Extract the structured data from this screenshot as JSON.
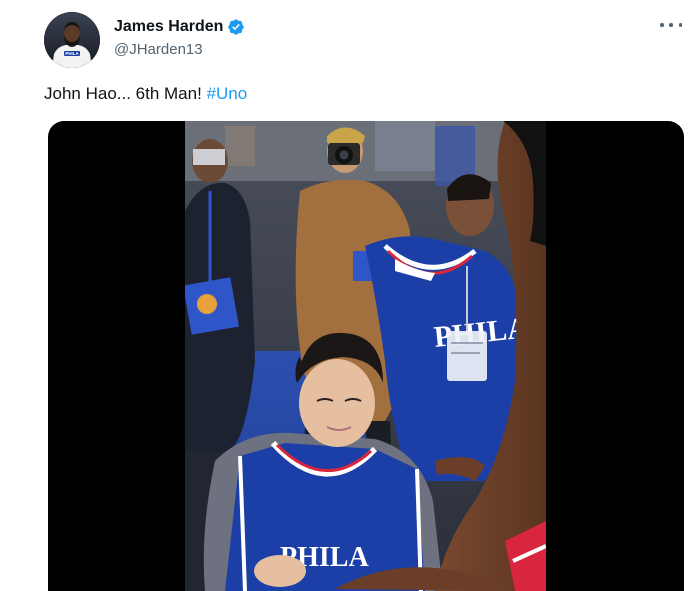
{
  "author": {
    "display_name": "James Harden",
    "handle": "@JHarden13",
    "verified": true,
    "avatar_jersey_text": "PHILA"
  },
  "tweet": {
    "text": "John Hao... 6th Man!",
    "hashtag": "#Uno"
  },
  "media": {
    "type": "video",
    "jersey_text": "PHILA"
  },
  "icons": {
    "verified": "verified-badge-icon",
    "more": "more-options-icon"
  },
  "colors": {
    "accent": "#1d9bf0",
    "secondary_text": "#536471",
    "primary_text": "#0f1419",
    "jersey_blue": "#1b3fa6",
    "jersey_red": "#d7263d"
  }
}
